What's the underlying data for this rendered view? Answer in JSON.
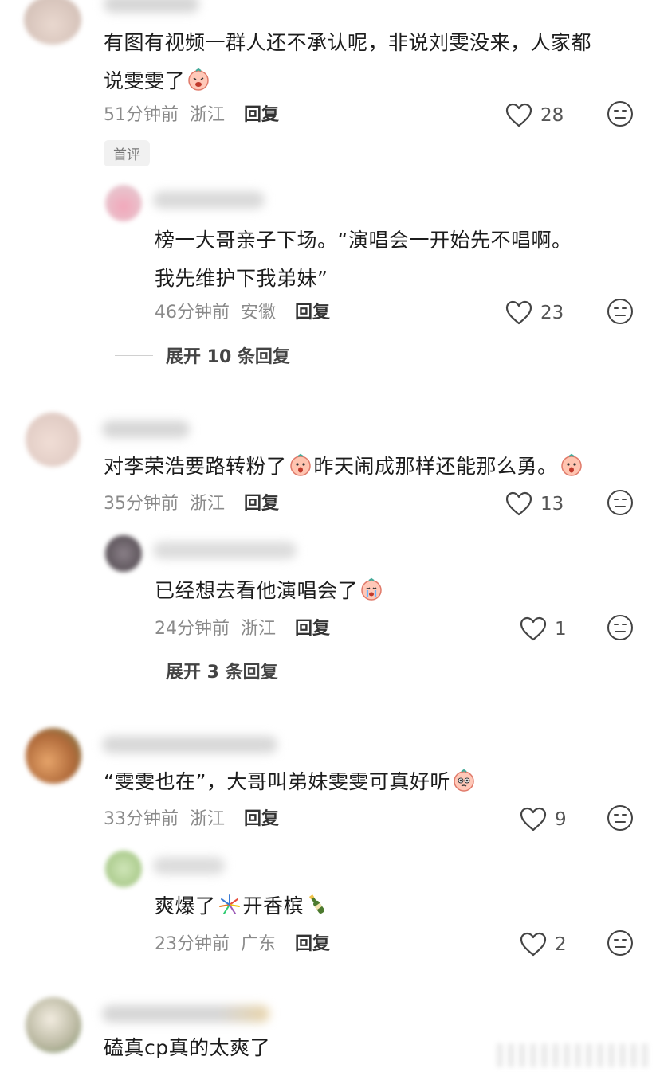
{
  "comments": [
    {
      "text_parts": [
        "有图有视频一群人还不承认呢，非说刘雯没来，人家都",
        "说雯雯了"
      ],
      "time": "51分钟前",
      "location": "浙江",
      "reply": "回复",
      "likes": "28",
      "badge": "首评",
      "reply_item": {
        "text_parts": [
          "榜一大哥亲子下场。“演唱会一开始先不唱啊。",
          "我先维护下我弟妹”"
        ],
        "time": "46分钟前",
        "location": "安徽",
        "reply": "回复",
        "likes": "23"
      },
      "expand": "展开 10 条回复"
    },
    {
      "text_parts": [
        "对李荣浩要路转粉了",
        "昨天闹成那样还能那么勇。"
      ],
      "time": "35分钟前",
      "location": "浙江",
      "reply": "回复",
      "likes": "13",
      "reply_item": {
        "text_parts": [
          "已经想去看他演唱会了"
        ],
        "time": "24分钟前",
        "location": "浙江",
        "reply": "回复",
        "likes": "1"
      },
      "expand": "展开 3 条回复"
    },
    {
      "text_parts": [
        "“雯雯也在”，大哥叫弟妹雯雯可真好听"
      ],
      "time": "33分钟前",
      "location": "浙江",
      "reply": "回复",
      "likes": "9",
      "reply_item": {
        "text_parts": [
          "爽爆了",
          "开香槟"
        ],
        "time": "23分钟前",
        "location": "广东",
        "reply": "回复",
        "likes": "2"
      }
    },
    {
      "text_parts": [
        "磕真cp真的太爽了"
      ]
    }
  ],
  "icons": {
    "like": "heart-outline-icon",
    "dislike": "neutral-face-icon"
  },
  "colors": {
    "meta": "#8a8a8a",
    "badge_bg": "#f1f1f1"
  }
}
